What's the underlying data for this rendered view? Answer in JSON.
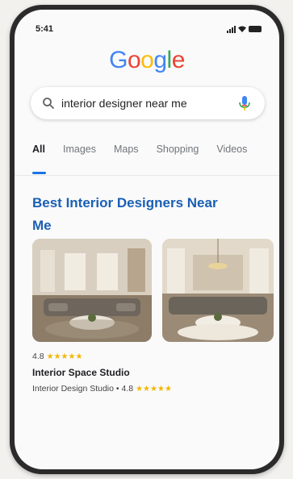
{
  "status_bar": {
    "time": "5:41"
  },
  "logo": {
    "letters": [
      "G",
      "o",
      "o",
      "g",
      "l",
      "e"
    ],
    "colors": [
      "#4285f4",
      "#ea4335",
      "#fbbc05",
      "#4285f4",
      "#34a853",
      "#ea4335"
    ]
  },
  "search": {
    "query": "interior designer near me"
  },
  "tabs": [
    {
      "label": "All",
      "active": true
    },
    {
      "label": "Images",
      "active": false
    },
    {
      "label": "Maps",
      "active": false
    },
    {
      "label": "Shopping",
      "active": false
    },
    {
      "label": "Videos",
      "active": false
    }
  ],
  "result": {
    "title": "Best Interior Designers Near Me",
    "rating": "4.8",
    "stars": "★★★★★",
    "name": "Interior Space Studio",
    "meta": "Interior Design Studio • 4.8",
    "meta_stars": "★★★★★"
  },
  "colors": {
    "accent": "#1a73e8",
    "title_link": "#1a5fb4",
    "star": "#f2b705"
  }
}
